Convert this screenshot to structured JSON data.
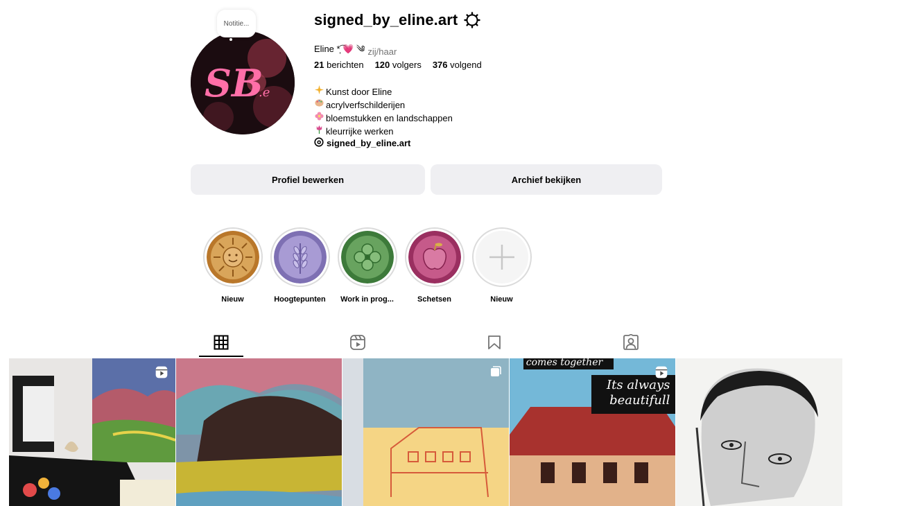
{
  "profile": {
    "username": "signed_by_eline.art",
    "note": "Notitie...",
    "display_name": "Eline *̩͡ 💗 ༄",
    "pronouns": "zij/haar",
    "stats": {
      "posts_count": "21",
      "posts_label": "berichten",
      "followers_count": "120",
      "followers_label": "volgers",
      "following_count": "376",
      "following_label": "volgend"
    },
    "bio": [
      {
        "icon": "sparkles-icon",
        "text": "Kunst door Eline"
      },
      {
        "icon": "palette-icon",
        "text": " acrylverfschilderijen"
      },
      {
        "icon": "flower-icon",
        "text": "bloemstukken en landschappen"
      },
      {
        "icon": "tulip-icon",
        "text": "kleurrijke werken"
      }
    ],
    "threads_handle": "signed_by_eline.art",
    "avatar_text": "SB.e"
  },
  "actions": {
    "edit_profile": "Profiel bewerken",
    "view_archive": "Archief bekijken"
  },
  "highlights": [
    {
      "label": "Nieuw",
      "icon": "sun-seal",
      "color": "#c98a3a"
    },
    {
      "label": "Hoogtepunten",
      "icon": "wheat-seal",
      "color": "#9a8cc7"
    },
    {
      "label": "Work in prog...",
      "icon": "clover-seal",
      "color": "#4f8b4a"
    },
    {
      "label": "Schetsen",
      "icon": "apple-seal",
      "color": "#b0477a"
    },
    {
      "label": "Nieuw",
      "icon": "plus-icon",
      "color": "#f5f5f5"
    }
  ],
  "tabs": [
    {
      "name": "posts",
      "icon": "grid-icon",
      "active": true
    },
    {
      "name": "reels",
      "icon": "reels-icon",
      "active": false
    },
    {
      "name": "saved",
      "icon": "bookmark-icon",
      "active": false
    },
    {
      "name": "tagged",
      "icon": "tagged-user-icon",
      "active": false
    }
  ],
  "posts": [
    {
      "type": "reel",
      "badge": "reels-icon"
    },
    {
      "type": "image",
      "badge": ""
    },
    {
      "type": "carousel",
      "badge": "carousel-icon"
    },
    {
      "type": "reel",
      "badge": "reels-icon",
      "overlay_top": "comes together",
      "overlay_text": "Its always beautifull"
    },
    {
      "type": "image",
      "badge": ""
    }
  ]
}
